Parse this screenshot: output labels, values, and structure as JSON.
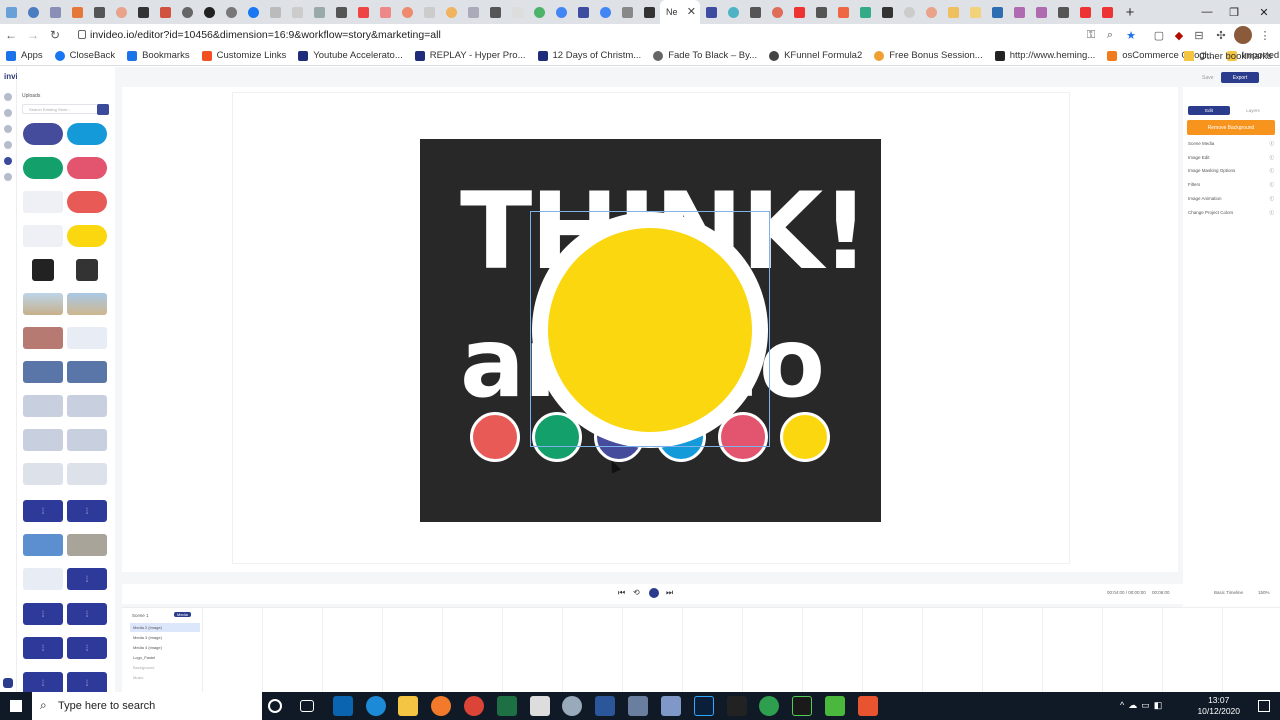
{
  "browser": {
    "active_tab_title": "Ne",
    "url": "invideo.io/editor?id=10456&dimension=16:9&workflow=story&marketing=all",
    "bookmarks": [
      "Apps",
      "CloseBack",
      "Bookmarks",
      "Customize Links",
      "Youtube Accelerato...",
      "REPLAY - Hyper Pro...",
      "12 Days of Christm...",
      "Fade To Black – By...",
      "KFunnel Formula2",
      "Free Bonus Session...",
      "http://www.heming...",
      "osCommerce Googl...",
      "Imported From IE"
    ],
    "other_bookmarks": "Other bookmarks",
    "more_bookmarks": "»"
  },
  "app": {
    "logo": "invideo",
    "library_header": "Uploads",
    "search_placeholder": "Search Existing Store...",
    "export_label": "Export",
    "undo_label": "Save"
  },
  "right_panel": {
    "tabs": [
      "Edit",
      "Layers"
    ],
    "remove_bg": "Remove Background",
    "items": [
      "Scene Media",
      "Image Edit",
      "Image Masking Options",
      "Filters",
      "Image Animation",
      "Change Project Colors"
    ]
  },
  "canvas": {
    "headline": "THINK!",
    "subline": "and do",
    "dot_colors": [
      "#e85a55",
      "#13a06b",
      "#454c9c",
      "#159ad9",
      "#e3546f",
      "#fbd70f"
    ],
    "big_circle_color": "#fbd70f"
  },
  "timeline": {
    "scene_label": "Scene 1",
    "scene_badge": "Media",
    "rows": [
      "Media 2 (image)",
      "Media 3 (image)",
      "Media 4 (image)",
      "Logo_Pastel",
      "Background",
      "Music"
    ],
    "time_display": "00:04:00 / 00:00:00",
    "duration": "00:06:00",
    "mode": "Basic Timeline",
    "zoom": "150%"
  },
  "taskbar": {
    "search_placeholder": "Type here to search",
    "time": "13:07",
    "date": "10/12/2020"
  }
}
